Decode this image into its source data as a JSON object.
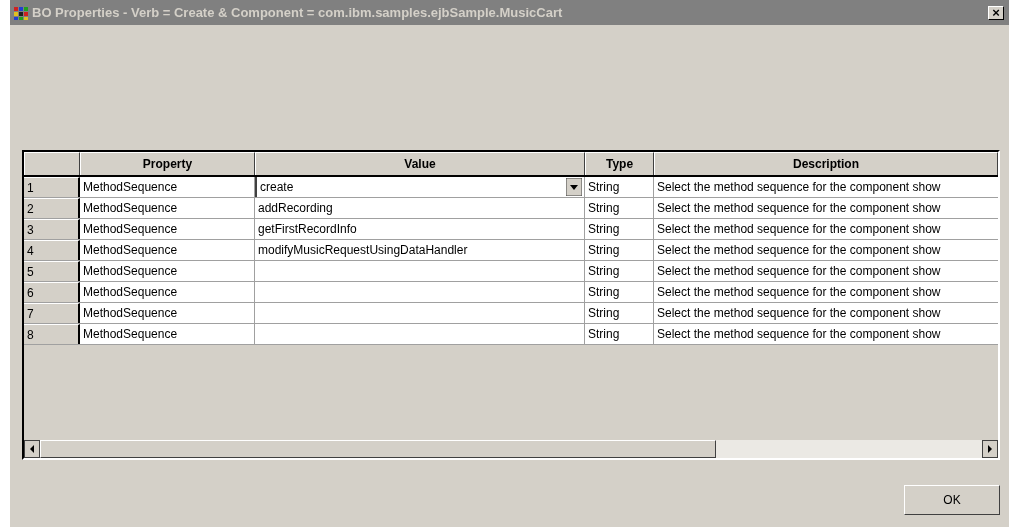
{
  "window": {
    "title": "BO Properties - Verb = Create & Component = com.ibm.samples.ejbSample.MusicCart",
    "close": "×"
  },
  "table": {
    "columns": [
      "Property",
      "Value",
      "Type",
      "Description"
    ],
    "rows": [
      {
        "kind": "dropdown",
        "index": "1",
        "property": "MethodSequence",
        "value": "create",
        "type": "String",
        "description": "Select the method sequence for the component show"
      },
      {
        "kind": "text",
        "index": "2",
        "property": "MethodSequence",
        "value": "addRecording",
        "type": "String",
        "description": "Select the method sequence for the component show"
      },
      {
        "kind": "text",
        "index": "3",
        "property": "MethodSequence",
        "value": "getFirstRecordInfo",
        "type": "String",
        "description": "Select the method sequence for the component show"
      },
      {
        "kind": "text",
        "index": "4",
        "property": "MethodSequence",
        "value": "modifyMusicRequestUsingDataHandler",
        "type": "String",
        "description": "Select the method sequence for the component show"
      },
      {
        "kind": "text",
        "index": "5",
        "property": "MethodSequence",
        "type": "String",
        "description": "Select the method sequence for the component show"
      },
      {
        "kind": "text",
        "index": "6",
        "property": "MethodSequence",
        "type": "String",
        "description": "Select the method sequence for the component show"
      },
      {
        "kind": "text",
        "index": "7",
        "property": "MethodSequence",
        "type": "String",
        "description": "Select the method sequence for the component show"
      },
      {
        "kind": "text",
        "index": "8",
        "property": "MethodSequence",
        "type": "String",
        "description": "Select the method sequence for the component show"
      }
    ]
  },
  "buttons": [
    "OK"
  ]
}
